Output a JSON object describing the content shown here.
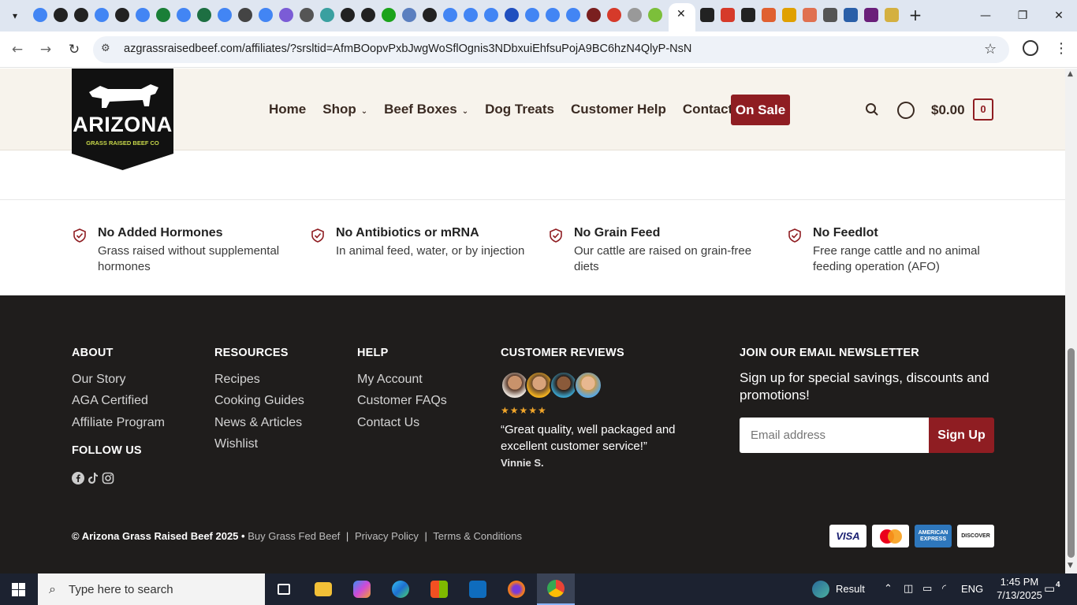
{
  "browser": {
    "url": "azgrassraisedbeef.com/affiliates/?srsltid=AfmBOopvPxbJwgWoSflOgnis3NDbxuiEhfsuPojA9BC6hzN4QlyP-NsN",
    "tabs_favicon_colors": [
      "#4285f4",
      "#222222",
      "#222222",
      "#4285f4",
      "#222222",
      "#4285f4",
      "#1a7f37",
      "#4285f4",
      "#1d6f42",
      "#4285f4",
      "#444444",
      "#4285f4",
      "#7b5cd6",
      "#555555",
      "#3aa0a0",
      "#222222",
      "#222222",
      "#1ba31b",
      "#5b7fbf",
      "#222222",
      "#4285f4",
      "#4285f4",
      "#4285f4",
      "#1f4fbf",
      "#4285f4",
      "#4285f4",
      "#4285f4",
      "#7a1f1f",
      "#d63a2a",
      "#999999",
      "#7cbf3a"
    ],
    "tabs_after_active_colors": [
      "#222222",
      "#d63a2a",
      "#222222",
      "#e06030",
      "#e0a000",
      "#e07050",
      "#555555",
      "#2a5fa8",
      "#6a1f7a",
      "#d4b040"
    ]
  },
  "site": {
    "logo_text": "ARIZONA",
    "logo_sub": "GRASS RAISED BEEF CO",
    "menu": [
      {
        "label": "Home",
        "has_caret": false
      },
      {
        "label": "Shop",
        "has_caret": true
      },
      {
        "label": "Beef Boxes",
        "has_caret": true
      },
      {
        "label": "Dog Treats",
        "has_caret": false
      },
      {
        "label": "Customer Help",
        "has_caret": false
      },
      {
        "label": "Contact Us",
        "has_caret": false
      }
    ],
    "on_sale": "On Sale",
    "cart_total": "$0.00",
    "cart_count": "0",
    "brand_color": "#8f1d22"
  },
  "features": [
    {
      "title": "No Added Hormones",
      "desc": "Grass raised without supplemental hormones"
    },
    {
      "title": "No Antibiotics or mRNA",
      "desc": "In animal feed, water, or by injection"
    },
    {
      "title": "No Grain Feed",
      "desc": "Our cattle are raised on grain-free diets"
    },
    {
      "title": "No Feedlot",
      "desc": "Free range cattle and no animal feeding operation (AFO)"
    }
  ],
  "footer": {
    "about": {
      "heading": "ABOUT",
      "links": [
        "Our Story",
        "AGA Certified",
        "Affiliate Program"
      ]
    },
    "follow": {
      "heading": "FOLLOW US",
      "icons": [
        "facebook-icon",
        "tiktok-icon",
        "instagram-icon"
      ]
    },
    "resources": {
      "heading": "RESOURCES",
      "links": [
        "Recipes",
        "Cooking Guides",
        "News & Articles",
        "Wishlist"
      ]
    },
    "help": {
      "heading": "HELP",
      "links": [
        "My Account",
        "Customer FAQs",
        "Contact Us"
      ]
    },
    "reviews": {
      "heading": "CUSTOMER REVIEWS",
      "stars": "★★★★★",
      "quote": "“Great quality, well packaged and excellent customer service!”",
      "reviewer": "Vinnie S."
    },
    "newsletter": {
      "heading": "JOIN OUR EMAIL NEWSLETTER",
      "text": "Sign up for special savings, discounts and promotions!",
      "placeholder": "Email address",
      "button": "Sign Up"
    },
    "copyright": "© Arizona Grass Raised Beef 2025",
    "bullet": "•",
    "legal_links": [
      "Buy Grass Fed Beef",
      "Privacy Policy",
      "Terms & Conditions"
    ],
    "divider": "|",
    "payments": [
      "VISA",
      "mastercard",
      "AMERICAN EXPRESS",
      "DISCOVER"
    ]
  },
  "taskbar": {
    "search_placeholder": "Type here to search",
    "result_label": "Result",
    "language": "ENG",
    "time": "1:45 PM",
    "date": "7/13/2025",
    "notifications": "4"
  }
}
